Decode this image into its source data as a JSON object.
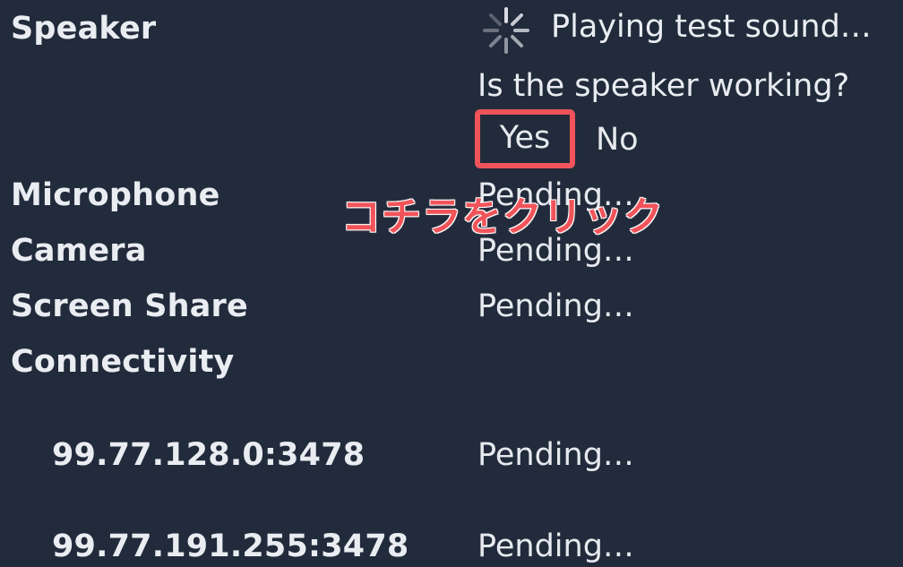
{
  "speaker": {
    "label": "Speaker",
    "status": "Playing test sound…",
    "question": "Is the speaker working?",
    "yes_label": "Yes",
    "no_label": "No"
  },
  "annotation": {
    "text": "コチラをクリック",
    "color": "#f0545a"
  },
  "checks": [
    {
      "label": "Microphone",
      "status": "Pending…"
    },
    {
      "label": "Camera",
      "status": "Pending…"
    },
    {
      "label": "Screen Share",
      "status": "Pending…"
    },
    {
      "label": "Connectivity",
      "status": ""
    }
  ],
  "connectivity_endpoints": [
    {
      "address": "99.77.128.0:3478",
      "status": "Pending…"
    },
    {
      "address": "99.77.191.255:3478",
      "status": "Pending…"
    }
  ],
  "colors": {
    "background": "#222b3b",
    "text": "#e9edf2",
    "highlight": "#f0545a"
  },
  "icons": {
    "spinner": "loading-spinner-icon"
  }
}
